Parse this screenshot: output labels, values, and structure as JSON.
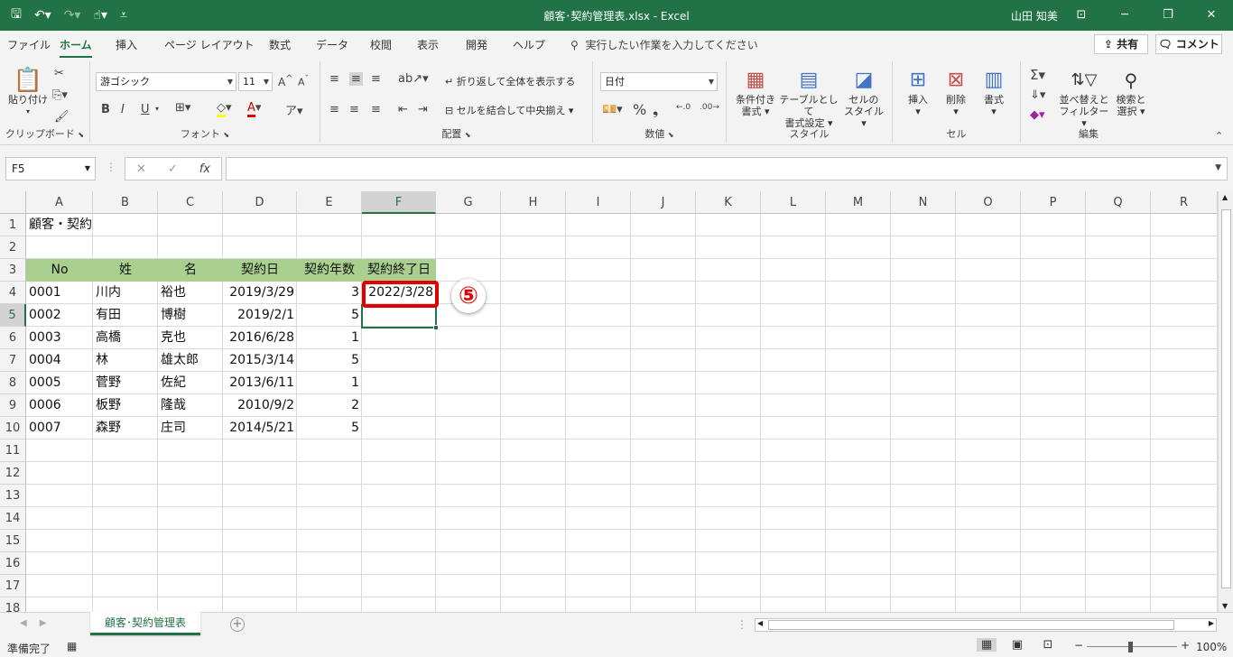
{
  "app": {
    "title": "顧客･契約管理表.xlsx  -  Excel",
    "user": "山田 知美",
    "accent": "#217346"
  },
  "qat": {
    "save_icon": "save-icon",
    "undo_icon": "undo-icon",
    "redo_icon": "redo-icon",
    "touch_icon": "touch-mode-icon"
  },
  "menu": {
    "tabs": [
      "ファイル",
      "ホーム",
      "挿入",
      "ページ レイアウト",
      "数式",
      "データ",
      "校閲",
      "表示",
      "開発",
      "ヘルプ"
    ],
    "active": "ホーム",
    "search": "実行したい作業を入力してください",
    "share": "共有",
    "comment": "コメント"
  },
  "ribbon": {
    "clipboard": {
      "label": "クリップボード",
      "paste": "貼り付け"
    },
    "font": {
      "label": "フォント",
      "font_name": "游ゴシック",
      "font_size": "11",
      "bold": "B",
      "italic": "I",
      "underline": "U"
    },
    "alignment": {
      "label": "配置",
      "wrap": "折り返して全体を表示する",
      "merge": "セルを結合して中央揃え"
    },
    "number": {
      "label": "数値",
      "format": "日付"
    },
    "styles": {
      "label": "スタイル",
      "conditional": [
        "条件付き",
        "書式"
      ],
      "table": [
        "テーブルとして",
        "書式設定"
      ],
      "cell": [
        "セルの",
        "スタイル"
      ]
    },
    "cells": {
      "label": "セル",
      "insert": "挿入",
      "delete": "削除",
      "format": "書式"
    },
    "editing": {
      "label": "編集",
      "sort": [
        "並べ替えと",
        "フィルター"
      ],
      "find": [
        "検索と",
        "選択"
      ]
    }
  },
  "formula_bar": {
    "name_box": "F5",
    "formula": ""
  },
  "columns": [
    "A",
    "B",
    "C",
    "D",
    "E",
    "F",
    "G",
    "H",
    "I",
    "J",
    "K",
    "L",
    "M",
    "N",
    "O",
    "P",
    "Q",
    "R"
  ],
  "rows": [
    "1",
    "2",
    "3",
    "4",
    "5",
    "6",
    "7",
    "8",
    "9",
    "10",
    "11",
    "12",
    "13",
    "14",
    "15",
    "16",
    "17",
    "18"
  ],
  "sheet": {
    "title": "顧客・契約管理表",
    "headers": [
      "No",
      "姓",
      "名",
      "契約日",
      "契約年数",
      "契約終了日"
    ],
    "data": [
      [
        "0001",
        "川内",
        "裕也",
        "2019/3/29",
        "3",
        "2022/3/28"
      ],
      [
        "0002",
        "有田",
        "博樹",
        "2019/2/1",
        "5",
        ""
      ],
      [
        "0003",
        "高橋",
        "克也",
        "2016/6/28",
        "1",
        ""
      ],
      [
        "0004",
        "林",
        "雄太郎",
        "2015/3/14",
        "5",
        ""
      ],
      [
        "0005",
        "菅野",
        "佐紀",
        "2013/6/11",
        "1",
        ""
      ],
      [
        "0006",
        "板野",
        "隆哉",
        "2010/9/2",
        "2",
        ""
      ],
      [
        "0007",
        "森野",
        "庄司",
        "2014/5/21",
        "5",
        ""
      ]
    ],
    "header_color": "#a9d08e",
    "callout_color": "#e00000"
  },
  "step_badge": "⑤",
  "tabs_bar": {
    "sheet_tab": "顧客･契約管理表"
  },
  "status": {
    "ready": "準備完了",
    "zoom": "100%"
  }
}
